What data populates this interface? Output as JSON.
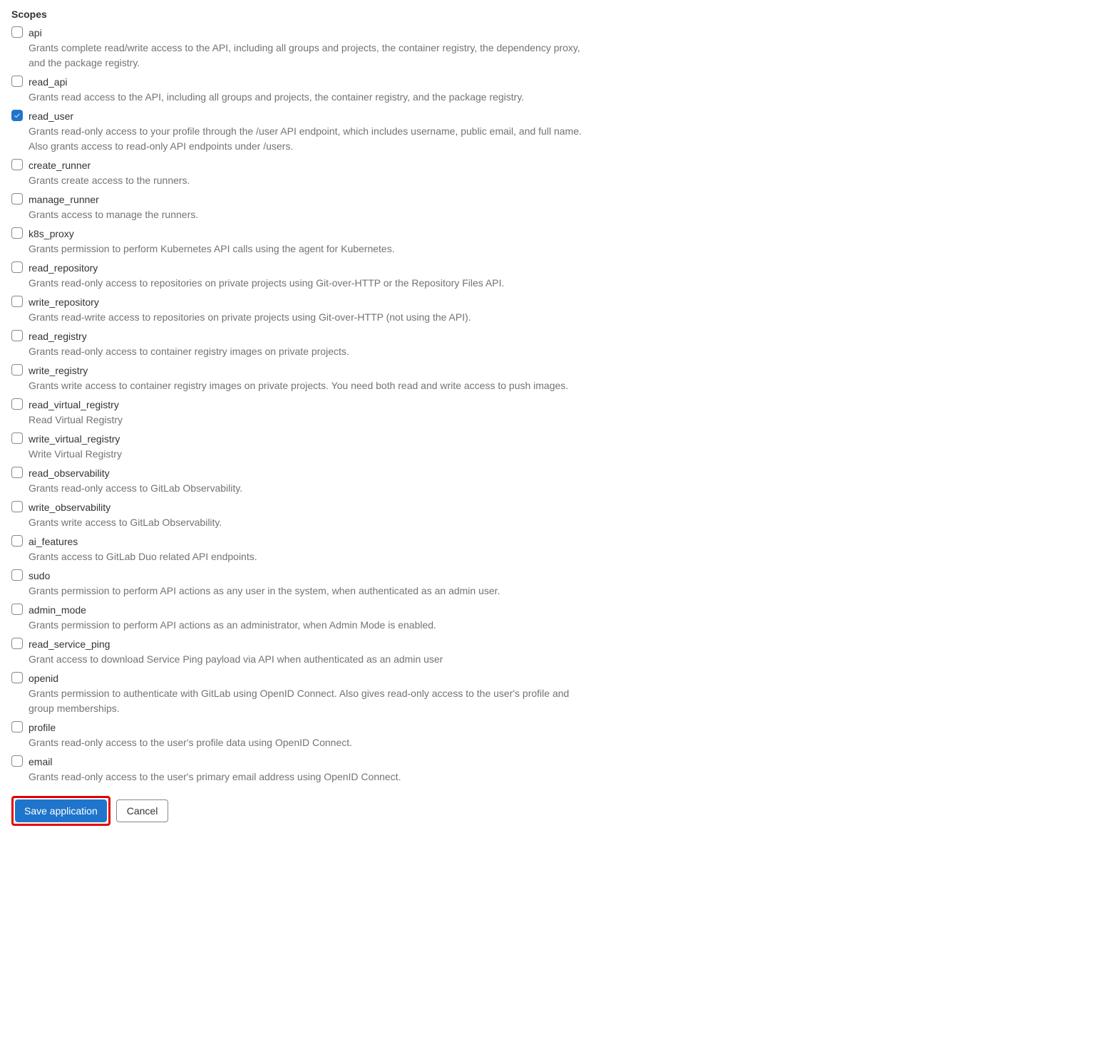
{
  "heading": "Scopes",
  "scopes": [
    {
      "name": "api",
      "description": "Grants complete read/write access to the API, including all groups and projects, the container registry, the dependency proxy, and the package registry.",
      "checked": false
    },
    {
      "name": "read_api",
      "description": "Grants read access to the API, including all groups and projects, the container registry, and the package registry.",
      "checked": false
    },
    {
      "name": "read_user",
      "description": "Grants read-only access to your profile through the /user API endpoint, which includes username, public email, and full name. Also grants access to read-only API endpoints under /users.",
      "checked": true
    },
    {
      "name": "create_runner",
      "description": "Grants create access to the runners.",
      "checked": false
    },
    {
      "name": "manage_runner",
      "description": "Grants access to manage the runners.",
      "checked": false
    },
    {
      "name": "k8s_proxy",
      "description": "Grants permission to perform Kubernetes API calls using the agent for Kubernetes.",
      "checked": false
    },
    {
      "name": "read_repository",
      "description": "Grants read-only access to repositories on private projects using Git-over-HTTP or the Repository Files API.",
      "checked": false
    },
    {
      "name": "write_repository",
      "description": "Grants read-write access to repositories on private projects using Git-over-HTTP (not using the API).",
      "checked": false
    },
    {
      "name": "read_registry",
      "description": "Grants read-only access to container registry images on private projects.",
      "checked": false
    },
    {
      "name": "write_registry",
      "description": "Grants write access to container registry images on private projects. You need both read and write access to push images.",
      "checked": false
    },
    {
      "name": "read_virtual_registry",
      "description": "Read Virtual Registry",
      "checked": false
    },
    {
      "name": "write_virtual_registry",
      "description": "Write Virtual Registry",
      "checked": false
    },
    {
      "name": "read_observability",
      "description": "Grants read-only access to GitLab Observability.",
      "checked": false
    },
    {
      "name": "write_observability",
      "description": "Grants write access to GitLab Observability.",
      "checked": false
    },
    {
      "name": "ai_features",
      "description": "Grants access to GitLab Duo related API endpoints.",
      "checked": false
    },
    {
      "name": "sudo",
      "description": "Grants permission to perform API actions as any user in the system, when authenticated as an admin user.",
      "checked": false
    },
    {
      "name": "admin_mode",
      "description": "Grants permission to perform API actions as an administrator, when Admin Mode is enabled.",
      "checked": false
    },
    {
      "name": "read_service_ping",
      "description": "Grant access to download Service Ping payload via API when authenticated as an admin user",
      "checked": false
    },
    {
      "name": "openid",
      "description": "Grants permission to authenticate with GitLab using OpenID Connect. Also gives read-only access to the user's profile and group memberships.",
      "checked": false
    },
    {
      "name": "profile",
      "description": "Grants read-only access to the user's profile data using OpenID Connect.",
      "checked": false
    },
    {
      "name": "email",
      "description": "Grants read-only access to the user's primary email address using OpenID Connect.",
      "checked": false
    }
  ],
  "buttons": {
    "save": "Save application",
    "cancel": "Cancel"
  }
}
